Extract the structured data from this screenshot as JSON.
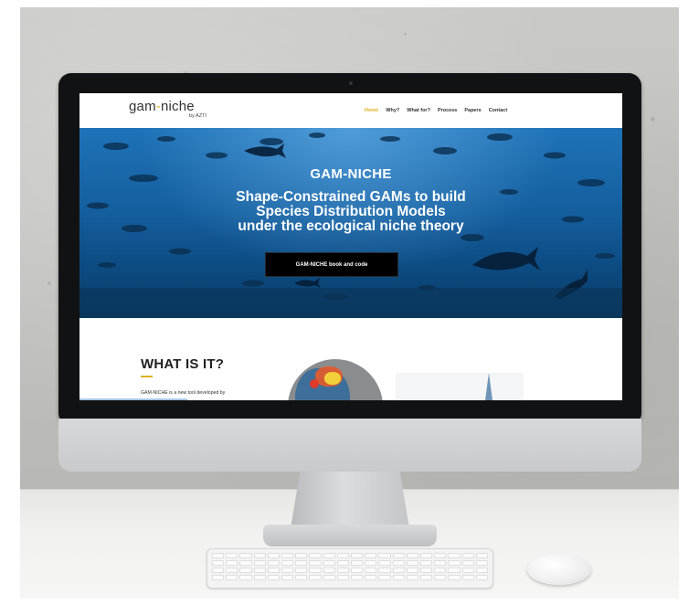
{
  "site": {
    "logo": {
      "main_pre": "gam",
      "main_dash": "-",
      "main_post": "niche",
      "sub": "by AZTI"
    },
    "nav": {
      "items": [
        {
          "label": "Home",
          "active": true
        },
        {
          "label": "Why?",
          "active": false
        },
        {
          "label": "What for?",
          "active": false
        },
        {
          "label": "Process",
          "active": false
        },
        {
          "label": "Papers",
          "active": false
        },
        {
          "label": "Contact",
          "active": false
        }
      ]
    },
    "hero": {
      "title": "GAM-NICHE",
      "subtitle_line1": "Shape-Constrained GAMs to build",
      "subtitle_line2": "Species Distribution Models",
      "subtitle_line3": "under the ecological niche theory",
      "button_label": "GAM-NICHE book and code"
    },
    "section": {
      "title": "WHAT IS IT?",
      "text": "GAM-NICHE is a new tool developed by"
    }
  },
  "colors": {
    "accent": "#e0b21f",
    "hero_blue": "#145e9e",
    "button_bg": "#000000",
    "monitor_bezel": "#111213"
  },
  "icons": {
    "globe": "globe-map-icon",
    "camera": "webcam-icon"
  }
}
